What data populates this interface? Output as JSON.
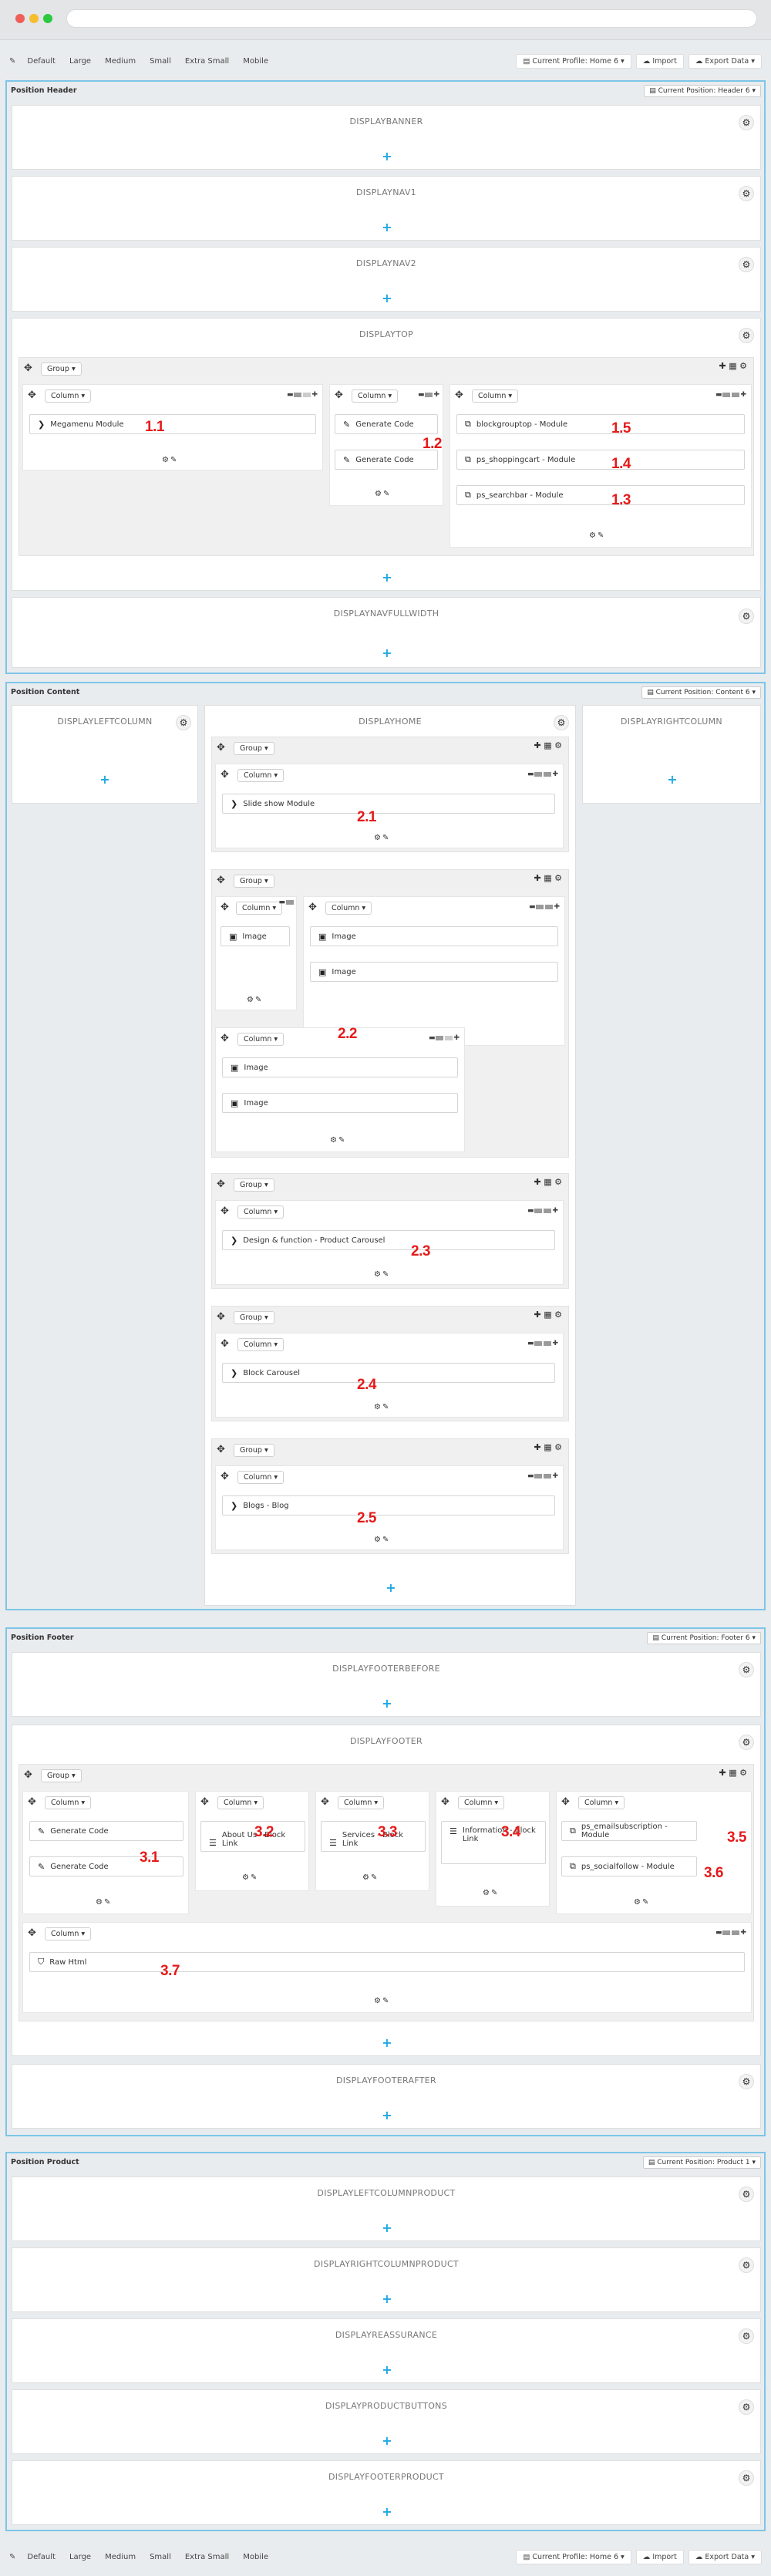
{
  "toolbar": {
    "labels": [
      "Default",
      "Large",
      "Medium",
      "Small",
      "Extra Small",
      "Mobile"
    ],
    "profile": "Current Profile: Home 6",
    "import": "Import",
    "export": "Export Data"
  },
  "sections": {
    "header": {
      "title": "Position Header",
      "position": "Current Position: Header 6"
    },
    "content": {
      "title": "Position Content",
      "position": "Current Position: Content 6"
    },
    "footer": {
      "title": "Position Footer",
      "position": "Current Position: Footer 6"
    },
    "product": {
      "title": "Position Product",
      "position": "Current Position: Product 1"
    }
  },
  "hooks": {
    "banner": "DISPLAYBANNER",
    "nav1": "DISPLAYNAV1",
    "nav2": "DISPLAYNAV2",
    "top": "DISPLAYTOP",
    "navfull": "DISPLAYNAVFULLWIDTH",
    "leftcol": "DISPLAYLEFTCOLUMN",
    "home": "DISPLAYHOME",
    "rightcol": "DISPLAYRIGHTCOLUMN",
    "footerbefore": "DISPLAYFOOTERBEFORE",
    "footer": "DISPLAYFOOTER",
    "footerafter": "DISPLAYFOOTERAFTER",
    "leftcolprod": "DISPLAYLEFTCOLUMNPRODUCT",
    "rightcolprod": "DISPLAYRIGHTCOLUMNPRODUCT",
    "reassurance": "DISPLAYREASSURANCE",
    "prodbuttons": "DISPLAYPRODUCTBUTTONS",
    "footerprod": "DISPLAYFOOTERPRODUCT"
  },
  "ui": {
    "group": "Group",
    "column": "Column"
  },
  "modules": {
    "megamenu": "Megamenu Module",
    "gencode": "Generate Code",
    "blockgrouptop": "blockgrouptop - Module",
    "shoppingcart": "ps_shoppingcart - Module",
    "searchbar": "ps_searchbar - Module",
    "slideshow": "Slide show Module",
    "image": "Image",
    "design": "Design & function - Product Carousel",
    "blockcarousel": "Block Carousel",
    "blogs": "Blogs - Blog",
    "aboutus": "About Us - Block Link",
    "services": "Services - Block Link",
    "information": "Information - Block Link",
    "emailsub": "ps_emailsubscription - Module",
    "socialfollow": "ps_socialfollow - Module",
    "rawhtml": "Raw Html"
  },
  "markers": [
    "1.1",
    "1.2",
    "1.5",
    "1.4",
    "1.3",
    "2.1",
    "2.2",
    "2.3",
    "2.4",
    "2.5",
    "3.2",
    "3.3",
    "3.4",
    "3.5",
    "3.1",
    "3.6",
    "3.7"
  ]
}
